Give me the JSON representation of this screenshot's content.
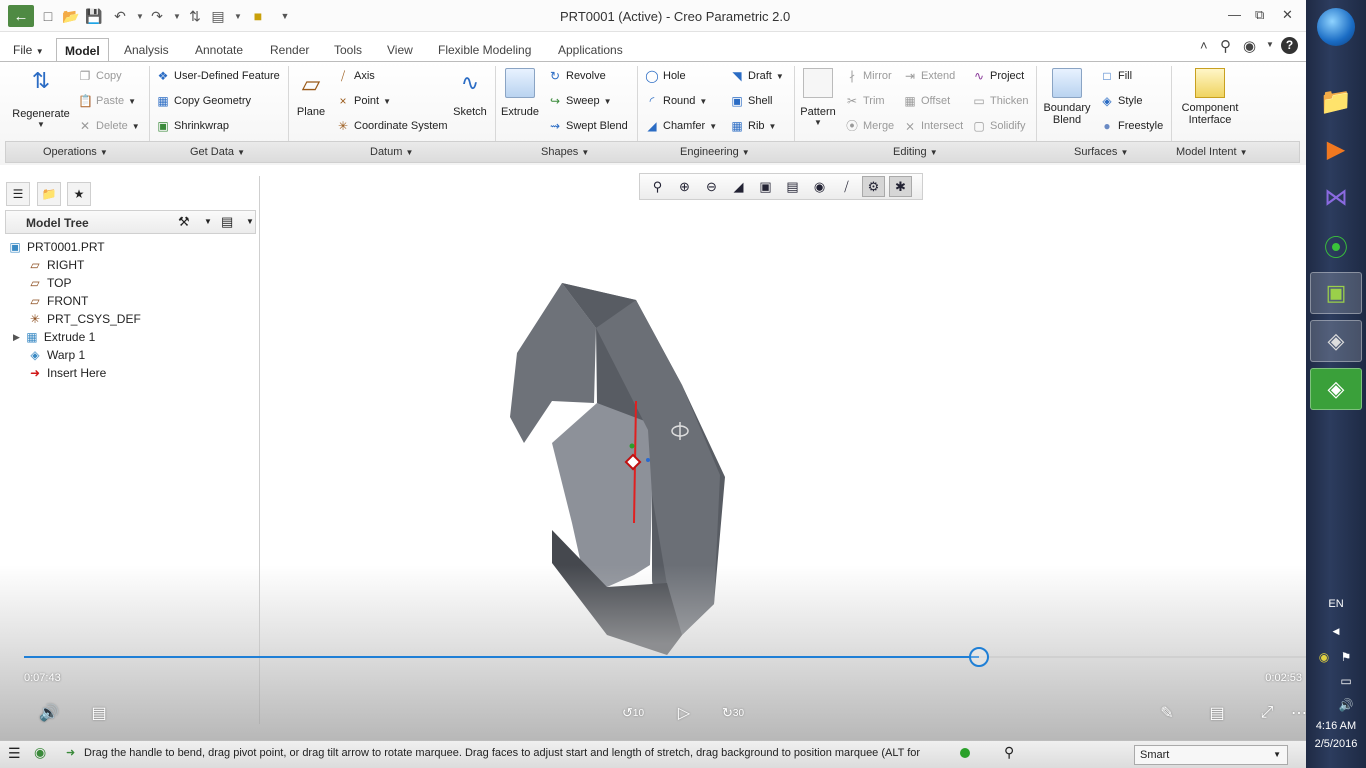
{
  "window": {
    "title": "PRT0001 (Active) - Creo Parametric 2.0"
  },
  "tabs": [
    {
      "label": "File",
      "active": false
    },
    {
      "label": "Model",
      "active": true
    },
    {
      "label": "Analysis",
      "active": false
    },
    {
      "label": "Annotate",
      "active": false
    },
    {
      "label": "Render",
      "active": false
    },
    {
      "label": "Tools",
      "active": false
    },
    {
      "label": "View",
      "active": false
    },
    {
      "label": "Flexible Modeling",
      "active": false
    },
    {
      "label": "Applications",
      "active": false
    }
  ],
  "ribbon": {
    "operations": {
      "regenerate": "Regenerate",
      "copy": "Copy",
      "paste": "Paste",
      "delete": "Delete"
    },
    "get_data": {
      "udf": "User-Defined Feature",
      "copy_geometry": "Copy Geometry",
      "shrinkwrap": "Shrinkwrap"
    },
    "datum": {
      "plane": "Plane",
      "axis": "Axis",
      "point": "Point",
      "csys": "Coordinate System",
      "sketch": "Sketch"
    },
    "shapes": {
      "extrude": "Extrude",
      "revolve": "Revolve",
      "sweep": "Sweep",
      "swept_blend": "Swept Blend"
    },
    "engineering": {
      "hole": "Hole",
      "round": "Round",
      "chamfer": "Chamfer",
      "draft": "Draft",
      "shell": "Shell",
      "rib": "Rib"
    },
    "editing": {
      "pattern": "Pattern",
      "mirror": "Mirror",
      "trim": "Trim",
      "merge": "Merge",
      "extend": "Extend",
      "offset": "Offset",
      "intersect": "Intersect",
      "project": "Project",
      "thicken": "Thicken",
      "solidify": "Solidify"
    },
    "surfaces": {
      "boundary_blend_1": "Boundary",
      "boundary_blend_2": "Blend",
      "fill": "Fill",
      "style": "Style",
      "freestyle": "Freestyle"
    },
    "model_intent": {
      "component_1": "Component",
      "component_2": "Interface"
    },
    "groups": [
      "Operations",
      "Get Data",
      "Datum",
      "Shapes",
      "Engineering",
      "Editing",
      "Surfaces",
      "Model Intent"
    ]
  },
  "model_tree": {
    "title": "Model Tree",
    "items": [
      {
        "label": "PRT0001.PRT",
        "icon": "part-icon"
      },
      {
        "label": "RIGHT",
        "icon": "datum-plane-icon"
      },
      {
        "label": "TOP",
        "icon": "datum-plane-icon"
      },
      {
        "label": "FRONT",
        "icon": "datum-plane-icon"
      },
      {
        "label": "PRT_CSYS_DEF",
        "icon": "csys-icon"
      },
      {
        "label": "Extrude 1",
        "icon": "extrude-icon"
      },
      {
        "label": "Warp 1",
        "icon": "warp-icon"
      },
      {
        "label": "Insert Here",
        "icon": "insert-arrow-icon"
      }
    ]
  },
  "video": {
    "elapsed": "0:07:43",
    "remaining": "0:02:53",
    "progress": 0.745,
    "skip_back": "10",
    "skip_forward": "30"
  },
  "status": {
    "message": "Drag the handle to bend, drag pivot point, or drag tilt arrow to rotate marquee. Drag faces to adjust start and length of stretch, drag background to position marquee (ALT for r",
    "filter": "Smart"
  },
  "taskbar": {
    "language": "EN",
    "time": "4:16 AM",
    "date": "2/5/2016"
  },
  "colors": {
    "accent": "#1f7fd6",
    "model_gray": "#6d7178",
    "taskbar": "#24324f"
  }
}
